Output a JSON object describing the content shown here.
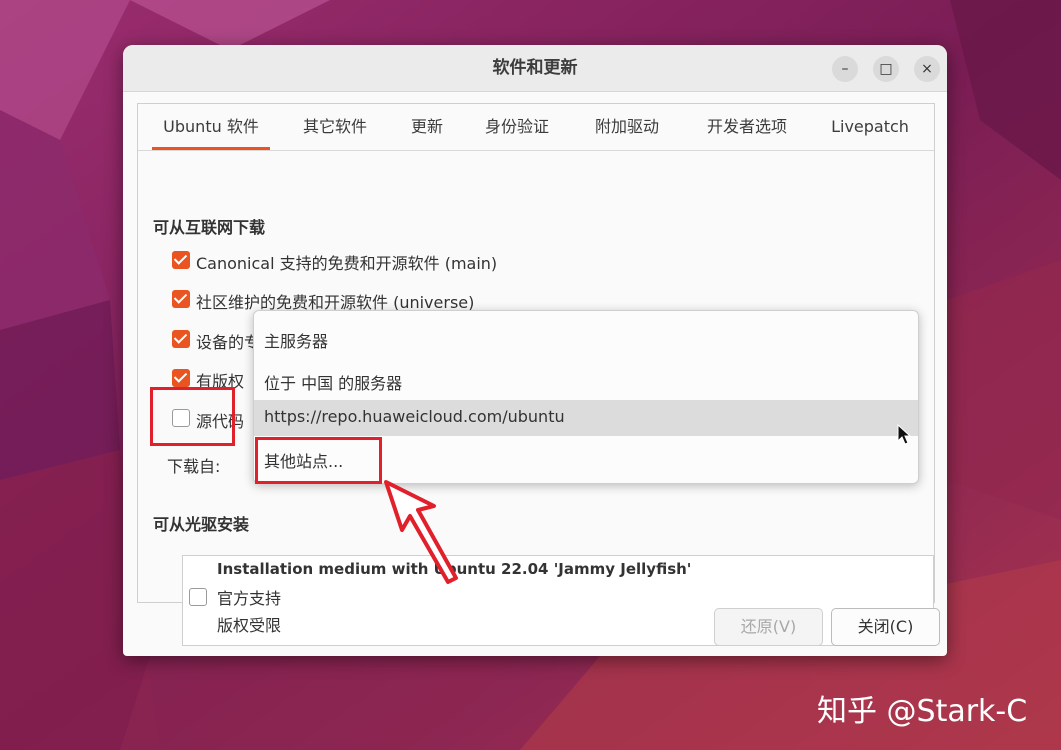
{
  "window": {
    "title": "软件和更新"
  },
  "window_controls": {
    "minimize": "–",
    "maximize": "□",
    "close": "×"
  },
  "tabs": [
    {
      "label": "Ubuntu 软件"
    },
    {
      "label": "其它软件"
    },
    {
      "label": "更新"
    },
    {
      "label": "身份验证"
    },
    {
      "label": "附加驱动"
    },
    {
      "label": "开发者选项"
    },
    {
      "label": "Livepatch"
    }
  ],
  "internet_section": {
    "heading": "可从互联网下载",
    "options": [
      {
        "label": "Canonical 支持的免费和开源软件 (main)",
        "checked": true
      },
      {
        "label": "社区维护的免费和开源软件 (universe)",
        "checked": true
      },
      {
        "label": "设备的专有驱动 (restricted)",
        "checked": true
      },
      {
        "label": "有版权",
        "checked": true
      },
      {
        "label": "源代码",
        "checked": false
      }
    ],
    "download_from_label": "下载自:"
  },
  "server_dropdown": {
    "items": [
      "主服务器",
      "位于 中国 的服务器",
      "https://repo.huaweicloud.com/ubuntu",
      "其他站点..."
    ],
    "highlighted_index": 2
  },
  "cdrom_section": {
    "heading": "可从光驱安装",
    "medium_title": "Installation medium with Ubuntu 22.04 'Jammy Jellyfish'",
    "medium_line2": "官方支持",
    "medium_line3": "版权受限",
    "checked": false
  },
  "buttons": {
    "revert": "还原(V)",
    "close": "关闭(C)"
  },
  "watermark": "知乎 @Stark-C",
  "colors": {
    "accent": "#e95420",
    "annotation": "#e0202a"
  }
}
